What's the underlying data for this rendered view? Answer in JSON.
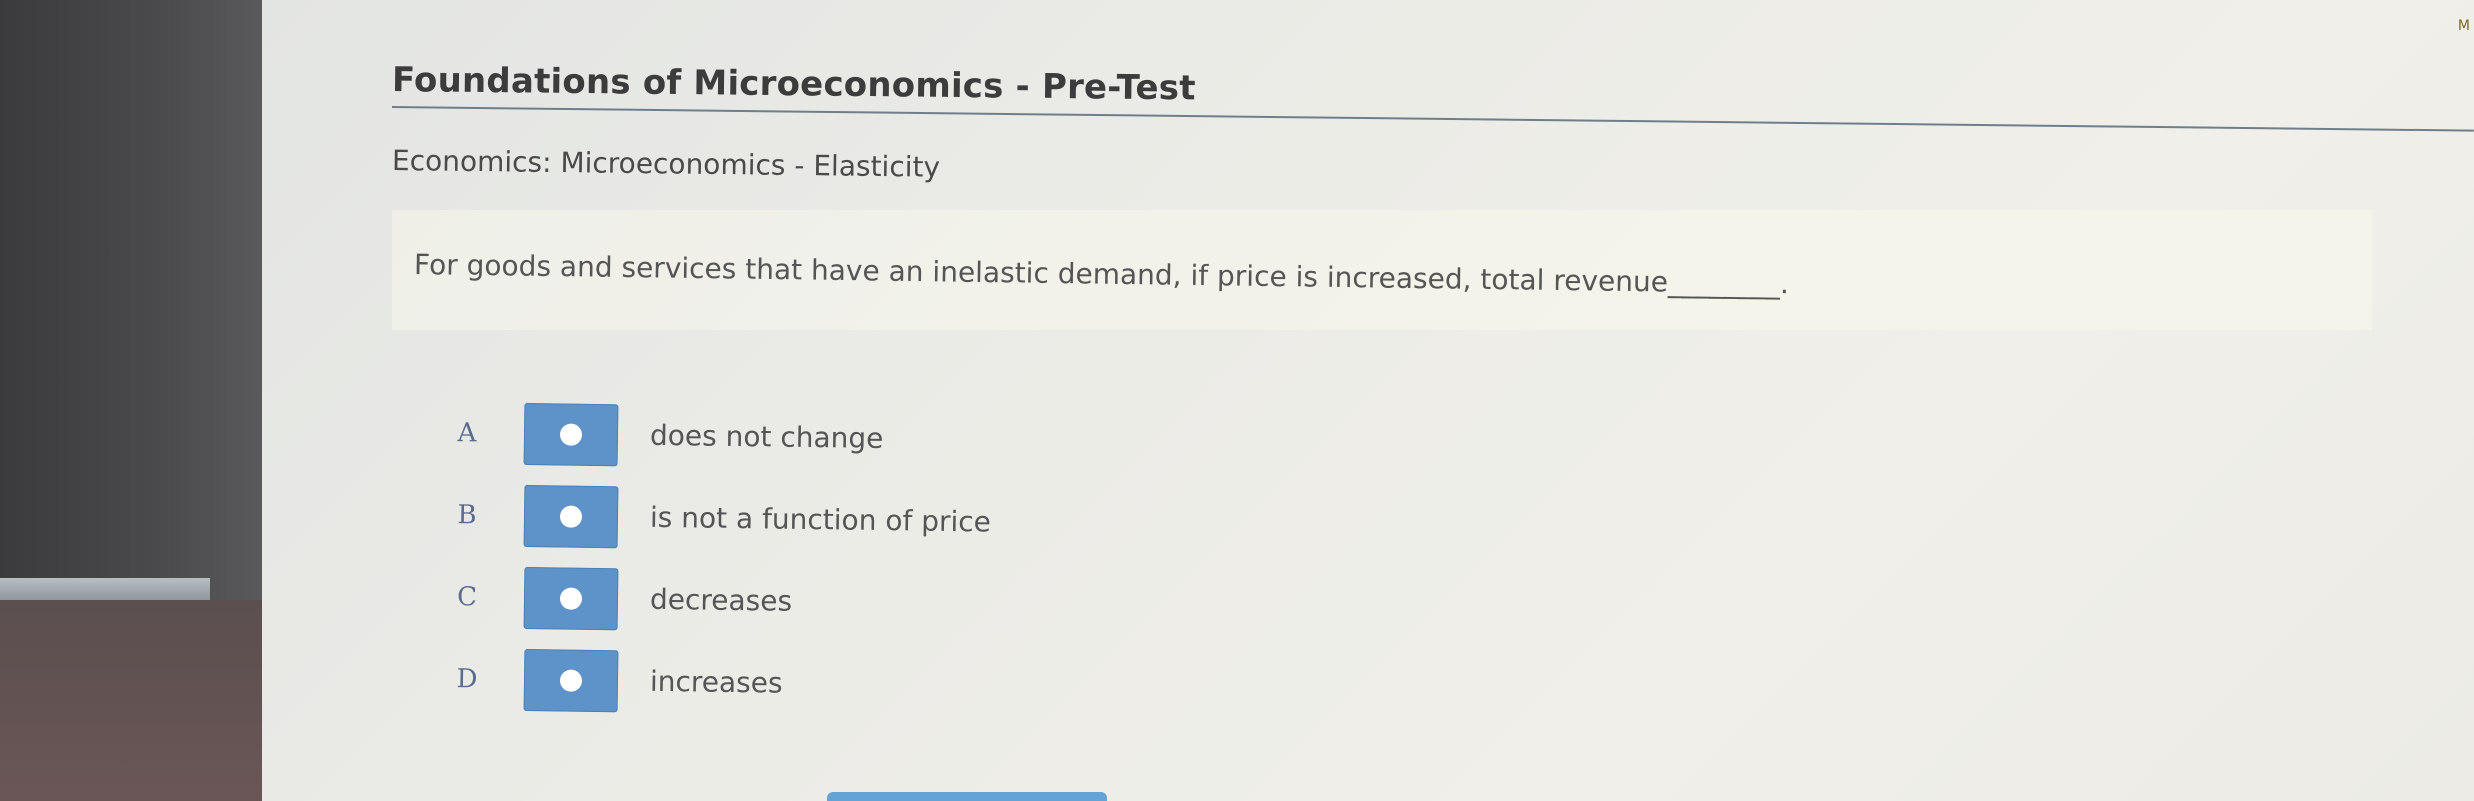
{
  "quiz": {
    "title": "Foundations of Microeconomics - Pre-Test",
    "subtitle": "Economics: Microeconomics - Elasticity",
    "question": "For goods and services that have an inelastic demand, if price is increased, total revenue________.",
    "options": [
      {
        "letter": "A",
        "text": "does not change"
      },
      {
        "letter": "B",
        "text": "is not a function of price"
      },
      {
        "letter": "C",
        "text": "decreases"
      },
      {
        "letter": "D",
        "text": "increases"
      }
    ],
    "corner_mark": "M"
  },
  "colors": {
    "radio_bg": "#5e93c9",
    "letter": "#5a6c8e",
    "title": "#3c3c3c",
    "text": "#555555"
  }
}
